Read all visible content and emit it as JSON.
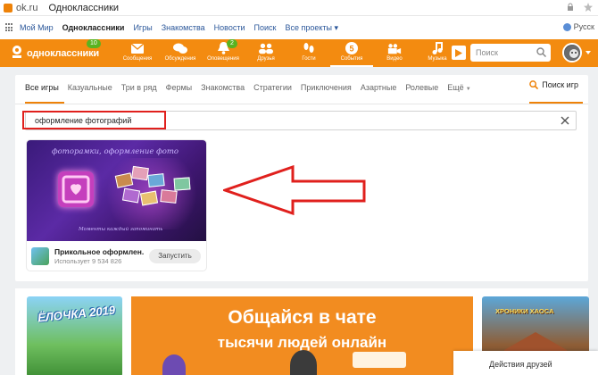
{
  "browser": {
    "url": "ok.ru",
    "title": "Одноклассники"
  },
  "portal": {
    "links": [
      "Мой Мир",
      "Одноклассники",
      "Игры",
      "Знакомства",
      "Новости",
      "Поиск",
      "Все проекты ▾"
    ],
    "language": "Русск"
  },
  "nav": {
    "logo": "одноклассники",
    "logo_badge": "10",
    "items": [
      {
        "label": "Сообщения",
        "icon": "envelope-icon"
      },
      {
        "label": "Обсуждения",
        "icon": "chat-bubbles-icon"
      },
      {
        "label": "Оповещения",
        "icon": "bell-icon",
        "badge": "2"
      },
      {
        "label": "Друзья",
        "icon": "friends-icon"
      },
      {
        "label": "Гости",
        "icon": "footprints-icon"
      },
      {
        "label": "События",
        "icon": "events-icon"
      },
      {
        "label": "Видео",
        "icon": "video-camera-icon"
      },
      {
        "label": "Музыка",
        "icon": "music-note-icon"
      }
    ],
    "search_placeholder": "Поиск",
    "accent": "#f38b10"
  },
  "games": {
    "tabs": [
      "Все игры",
      "Казуальные",
      "Три в ряд",
      "Фермы",
      "Знакомства",
      "Стратегии",
      "Приключения",
      "Азартные",
      "Ролевые",
      "Ещё"
    ],
    "search_games": "Поиск игр",
    "search_value": "оформление фотографий",
    "game": {
      "image_title": "фоторамки, оформление фото",
      "image_caption": "Моменты каждый запоминать",
      "name": "Прикольное оформлен...",
      "users": "Использует 9 534 826",
      "launch": "Запустить"
    }
  },
  "promos": {
    "left_title": "ЁЛОЧКА 2019",
    "center_title": "Общайся в чате",
    "center_sub": "тысячи людей онлайн",
    "right_title": "ХРОНИКИ ХАОСА"
  },
  "friends_actions": "Действия друзей",
  "annotation_color": "#e0201d"
}
